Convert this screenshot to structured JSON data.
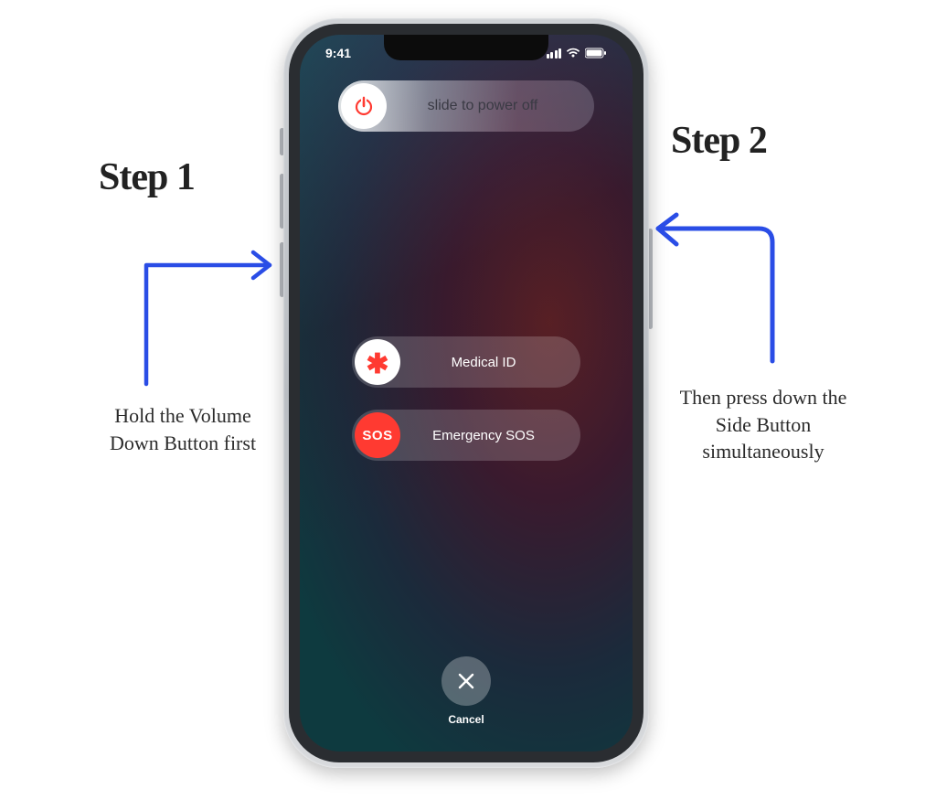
{
  "status": {
    "time": "9:41"
  },
  "sliders": {
    "power_label": "slide to power off",
    "medical_label": "Medical ID",
    "sos_label": "Emergency SOS",
    "sos_knob_text": "SOS"
  },
  "cancel": {
    "label": "Cancel"
  },
  "annotations": {
    "step1": {
      "title": "Step 1",
      "desc": "Hold the Volume Down Button first"
    },
    "step2": {
      "title": "Step 2",
      "desc": "Then press down the Side Button simultaneously"
    }
  }
}
